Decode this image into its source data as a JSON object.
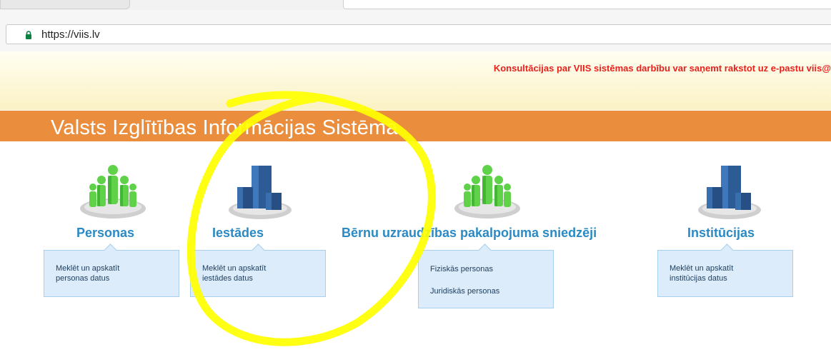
{
  "browser": {
    "url": "https://viis.lv",
    "lock_icon": "lock-icon"
  },
  "notice": {
    "text": "Konsultācijas par VIIS sistēmas darbību var saņemt rakstot uz e-pastu viis@",
    "color": "#e8211d"
  },
  "header": {
    "title": "Valsts  Izglītības Informācijas Sistēma",
    "bar_color": "#ea8e3d"
  },
  "sections": [
    {
      "icon": "people-icon",
      "title": "Personas",
      "lines": [
        "Meklēt un apskatīt",
        "personas datus"
      ]
    },
    {
      "icon": "servers-icon",
      "title": "Iestādes",
      "lines": [
        "Meklēt un apskatīt",
        "iestādes datus"
      ]
    },
    {
      "icon": "people-icon",
      "title": "Bērnu uzraudzības pakalpojuma sniedzēji",
      "links": [
        "Fiziskās personas",
        "Juridiskās personas"
      ]
    },
    {
      "icon": "servers-icon",
      "title": "Institūcijas",
      "lines": [
        "Meklēt un apskatīt",
        "institūcijas datus"
      ]
    }
  ],
  "annotation": {
    "shape": "freehand-circle",
    "color": "#ffff00"
  },
  "colors": {
    "accent": "#2b8ac4",
    "box_bg": "#dcecfa",
    "box_border": "#a8d0ee"
  }
}
